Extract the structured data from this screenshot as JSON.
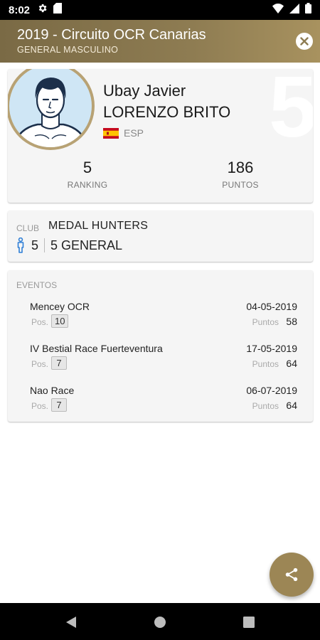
{
  "status_bar": {
    "time": "8:02",
    "icons_left": [
      "gear-icon",
      "sd-card-icon"
    ],
    "icons_right": [
      "wifi-icon",
      "signal-icon",
      "battery-icon"
    ]
  },
  "header": {
    "title": "2019 - Circuito OCR Canarias",
    "subtitle": "GENERAL MASCULINO",
    "close_icon": "close-icon",
    "color": "#8e7c52"
  },
  "profile": {
    "rank_watermark": "5",
    "first_name": "Ubay Javier",
    "last_name": "LORENZO BRITO",
    "country_code": "ESP",
    "flag": "spain-flag-icon",
    "ranking_value": "5",
    "ranking_label": "RANKING",
    "points_value": "186",
    "points_label": "PUNTOS"
  },
  "club": {
    "label": "CLUB",
    "name": "MEDAL HUNTERS",
    "category_rank": "5",
    "general_rank": "5 GENERAL",
    "gender_icon": "male-figure-icon"
  },
  "events": {
    "title": "EVENTOS",
    "pos_label": "Pos.",
    "points_label": "Puntos",
    "items": [
      {
        "name": "Mencey OCR",
        "date": "04-05-2019",
        "pos": "10",
        "points": "58"
      },
      {
        "name": "IV Bestial Race Fuerteventura",
        "date": "17-05-2019",
        "pos": "7",
        "points": "64"
      },
      {
        "name": "Nao Race",
        "date": "06-07-2019",
        "pos": "7",
        "points": "64"
      }
    ]
  },
  "fab": {
    "icon": "share-icon",
    "color": "#9c8655"
  },
  "nav_bar": {
    "buttons": [
      "back-icon",
      "home-icon",
      "recents-icon"
    ]
  }
}
